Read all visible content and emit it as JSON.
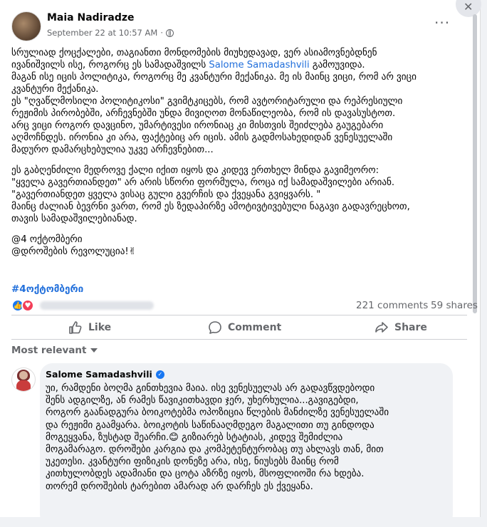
{
  "post": {
    "author": "Maia Nadiradze",
    "timestamp": "September 22 at 10:57 AM",
    "separator": "·",
    "menu_label": "···",
    "close_label": "✕",
    "text": {
      "p1_before": "სრულიად ქოცქალები, თაგიანთი მონდომების მიუხედავად, ვერ ასიამოვნებდნენ\nივანიშვილს ისე, როგორც ეს სამადაშვილს ",
      "p1_mention": "Salome Samadashvili",
      "p1_after": " გამოუვიდა.",
      "p1_rest": "მაგან ისე იცის პოლიტიკა, როგორც მე კვანტური მექანიკა. მე ის მაინც ვიცი, რომ არ ვიცი\nკვანტური მექანიკა.\nეს \"ღვაწლმოსილი პოლიტიკოსი\" გვიმტკიცებს, რომ ავტორიტარული და რეპრესიული\nრეჟიმის პირობებში, არჩევნებში უნდა მივიღოთ მონაწილეობა, რომ ის დავასუსტოთ.\nარც ვიცი როგორ დავცინო, უმარტივესი ირონიაც კი მისთვის შეიძლება გაუგებარი\nაღმოჩნდეს. ირონია კი არა, ფაქტებიც არ იცის. ამის გადმოსახედიდან ვენესუელაში\nმადურო დამარცხებულია უკვე არჩევნებით...",
      "p2": "ეს გაბღენძილი მედროვე ქალი იქით იყოს და კიდევ ერთხელ მინდა გავიმეორო:\n\"ყველა გავერთიანდეთ\" არ არის სწორი ფორმულა, როცა იქ სამადაშვილები არიან.\n\"გავერთიანდეთ ყველა ვისაც გული გვერჩის და ქვეყანა გვიყვარს. \"\nმაინც ძალიან ბევრნი ვართ, რომ ეს ზედაპირზე ამოტივტივებული ნაგავი გადავრეცხოთ,\nთავის სამადაშვილებიანად.",
      "p3": "@4 ოქტომბერი\n@დროშების რევოლუცია!✌"
    },
    "hashtag": "#4ოქტომბერი"
  },
  "stats": {
    "comments": "221 comments",
    "shares": "59 shares"
  },
  "actions": {
    "like": "Like",
    "comment": "Comment",
    "share": "Share"
  },
  "comments_filter": "Most relevant",
  "comment": {
    "author": "Salome Samadashvili",
    "text": "უი, რამდენი ბოღმა გინთხევია მაია. ისე ვენესუელას არ გადავწვდებოდი\nშენს ადგილზე, ან რამეს წავიკითხავდი ჯერ, უხერხულია...გავიგებდი,\nროგორ გაანადგურა ბოიკოტებმა ოპოზიცია წლების მანძილზე ვენესუელაში\nდა რეჟიმი გაამყარა. ბოიკოტის საწინააღმდეგო მაგალითი თუ გინდოდა\nმოგეყვანა, ზუსტად შეარჩი.😊 გიზიარებ სტატიას, კიდევ შემიძლია\nმოგამარაგო. დროშები კარგია და კომპეტენტურობაც თუ ახლავს თან, მით\nუკეთესი. კვანტური ფიზიკის დონეზე არა, ისე, ნიუსებს მაინც რომ\nკითხულობდეს ადამიანი და ცოტა აზრზე იყოს, მსოფლიოში რა ხდება.\nთორემ დროშების ტარებით ამარად არ დარჩეს ეს ქვეყანა."
  }
}
